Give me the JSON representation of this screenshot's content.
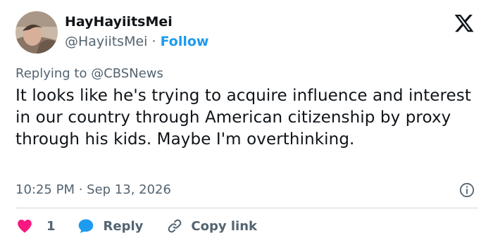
{
  "author": {
    "display_name": "HayHayiitsMei",
    "handle": "@HayiitsMei",
    "separator": " · ",
    "follow_label": "Follow"
  },
  "reply_context": {
    "prefix": "Replying to ",
    "target": "@CBSNews"
  },
  "tweet": {
    "text": "It looks like he's trying to acquire influence and interest in our country through American citizenship by proxy through his kids. Maybe I'm overthinking.",
    "timestamp": "10:25 PM · Sep 13, 2026"
  },
  "actions": {
    "like_count": "1",
    "reply_label": "Reply",
    "copy_link_label": "Copy link"
  },
  "icons": {
    "logo": "x-logo-icon",
    "info": "info-icon",
    "like": "heart-icon",
    "reply": "speech-bubble-icon",
    "copy_link": "link-icon"
  },
  "colors": {
    "text": "#0f1419",
    "secondary": "#536471",
    "accent": "#1d9bf0",
    "like": "#f91880",
    "divider": "#cfd9de"
  }
}
